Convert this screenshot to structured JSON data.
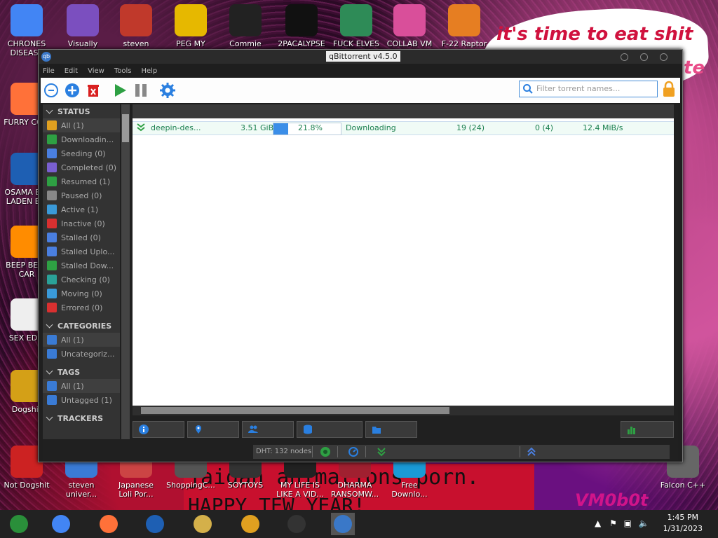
{
  "desktop": {
    "wallpaper_text": "it's time to eat shit",
    "wallpaper_text2": "te",
    "banner_line1": "jaidan animations porn.",
    "banner_line2": "HAPPY TEW YEAR!",
    "watermark": "VM0b0t",
    "icons": [
      {
        "label": "CHRONES DISEASE"
      },
      {
        "label": "Visually"
      },
      {
        "label": "steven"
      },
      {
        "label": "PEG MY WIFE!"
      },
      {
        "label": "Commie"
      },
      {
        "label": "2PACALYPSE"
      },
      {
        "label": "FUCK ELVES"
      },
      {
        "label": "COLLAB VM"
      },
      {
        "label": "F-22 Raptor"
      },
      {
        "label": "FURRY CO..."
      },
      {
        "label": "OSAMA BIN LADEN E..."
      },
      {
        "label": "BEEP BEEP CAR"
      },
      {
        "label": "SEX EDIT"
      },
      {
        "label": "Dogshit"
      },
      {
        "label": "Not Dogshit"
      },
      {
        "label": "steven univer..."
      },
      {
        "label": "Japanese Loli Por..."
      },
      {
        "label": "ShoppingC..."
      },
      {
        "label": "SOYTOYS"
      },
      {
        "label": "MY LIFE IS LIKE A VID..."
      },
      {
        "label": "DHARMA RANSOMW..."
      },
      {
        "label": "Free Downlo..."
      },
      {
        "label": "Falcon C++"
      }
    ]
  },
  "window": {
    "title": "qBittorrent v4.5.0",
    "app_icon_label": "qb",
    "menu": [
      "File",
      "Edit",
      "View",
      "Tools",
      "Help"
    ],
    "search_placeholder": "Filter torrent names...",
    "sidebar": {
      "status_header": "STATUS",
      "status_items": [
        {
          "label": "All (1)",
          "icon": "shuffle-icon",
          "color": "#e0a020"
        },
        {
          "label": "Downloadin...",
          "icon": "download-icon",
          "color": "#2ea043"
        },
        {
          "label": "Seeding (0)",
          "icon": "seeding-icon",
          "color": "#4a7fe0"
        },
        {
          "label": "Completed (0)",
          "icon": "check-icon",
          "color": "#7a5fd0"
        },
        {
          "label": "Resumed (1)",
          "icon": "play-icon",
          "color": "#2ea043"
        },
        {
          "label": "Paused (0)",
          "icon": "pause-icon",
          "color": "#888888"
        },
        {
          "label": "Active (1)",
          "icon": "active-icon",
          "color": "#3a9ad9"
        },
        {
          "label": "Inactive (0)",
          "icon": "inactive-icon",
          "color": "#d93030"
        },
        {
          "label": "Stalled (0)",
          "icon": "stalled-icon",
          "color": "#4a7fe0"
        },
        {
          "label": "Stalled Uplo...",
          "icon": "stalled-upload-icon",
          "color": "#4a7fe0"
        },
        {
          "label": "Stalled Dow...",
          "icon": "stalled-download-icon",
          "color": "#2ea043"
        },
        {
          "label": "Checking (0)",
          "icon": "checking-icon",
          "color": "#2aa198"
        },
        {
          "label": "Moving (0)",
          "icon": "moving-icon",
          "color": "#3a9ad9"
        },
        {
          "label": "Errored (0)",
          "icon": "error-icon",
          "color": "#d93030"
        }
      ],
      "categories_header": "CATEGORIES",
      "category_items": [
        {
          "label": "All (1)",
          "icon": "list-icon"
        },
        {
          "label": "Uncategoriz...",
          "icon": "list-icon"
        }
      ],
      "tags_header": "TAGS",
      "tag_items": [
        {
          "label": "All (1)",
          "icon": "tag-icon"
        },
        {
          "label": "Untagged (1)",
          "icon": "tag-icon"
        }
      ],
      "trackers_header": "TRACKERS"
    },
    "torrents": [
      {
        "name": "deepin-des...",
        "size": "3.51 GiB",
        "progress": 21.8,
        "progress_text": "21.8%",
        "status": "Downloading",
        "seeds": "19 (24)",
        "peers": "0 (4)",
        "down_speed": "12.4 MiB/s"
      }
    ],
    "statusbar": {
      "dht": "DHT: 132 nodes"
    }
  },
  "taskbar": {
    "time": "1:45 PM",
    "date": "1/31/2023",
    "apps": [
      "virtualbox-icon",
      "chrome-icon",
      "firefox-icon",
      "obama-icon",
      "explorer-icon",
      "runner-icon",
      "terminal-icon",
      "qbittorrent-icon"
    ]
  }
}
